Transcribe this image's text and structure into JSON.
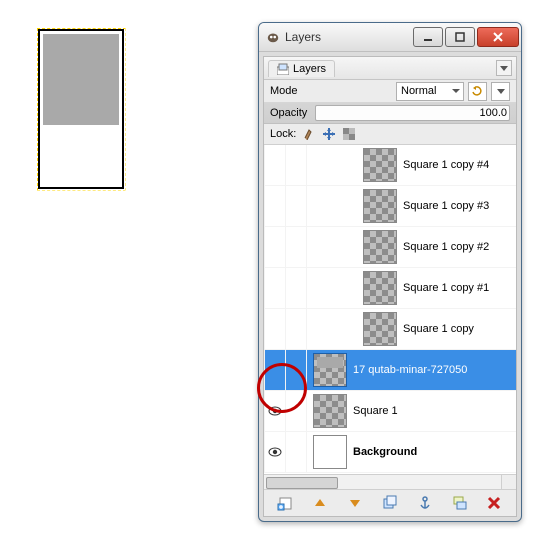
{
  "window": {
    "title": "Layers",
    "tab_label": "Layers"
  },
  "mode": {
    "label": "Mode",
    "value": "Normal"
  },
  "opacity": {
    "label": "Opacity",
    "value": "100.0"
  },
  "lock": {
    "label": "Lock:"
  },
  "layers": [
    {
      "name": "Square 1 copy #4",
      "indent": true,
      "visible": false,
      "selected": false,
      "thumb": "checker",
      "bold": false
    },
    {
      "name": "Square 1 copy #3",
      "indent": true,
      "visible": false,
      "selected": false,
      "thumb": "checker",
      "bold": false
    },
    {
      "name": "Square 1 copy #2",
      "indent": true,
      "visible": false,
      "selected": false,
      "thumb": "checker",
      "bold": false
    },
    {
      "name": "Square 1 copy #1",
      "indent": true,
      "visible": false,
      "selected": false,
      "thumb": "checker",
      "bold": false
    },
    {
      "name": "Square 1 copy",
      "indent": true,
      "visible": false,
      "selected": false,
      "thumb": "checker",
      "bold": false
    },
    {
      "name": "17 qutab-minar-727050",
      "indent": false,
      "visible": false,
      "selected": true,
      "thumb": "checker-fg",
      "bold": false
    },
    {
      "name": "Square 1",
      "indent": false,
      "visible": true,
      "selected": false,
      "thumb": "checker",
      "bold": false
    },
    {
      "name": "Background",
      "indent": false,
      "visible": true,
      "selected": false,
      "thumb": "white",
      "bold": true
    }
  ],
  "icons": {
    "app": "gimp-icon",
    "min": "minimize-icon",
    "max": "maximize-icon",
    "close": "close-icon"
  }
}
